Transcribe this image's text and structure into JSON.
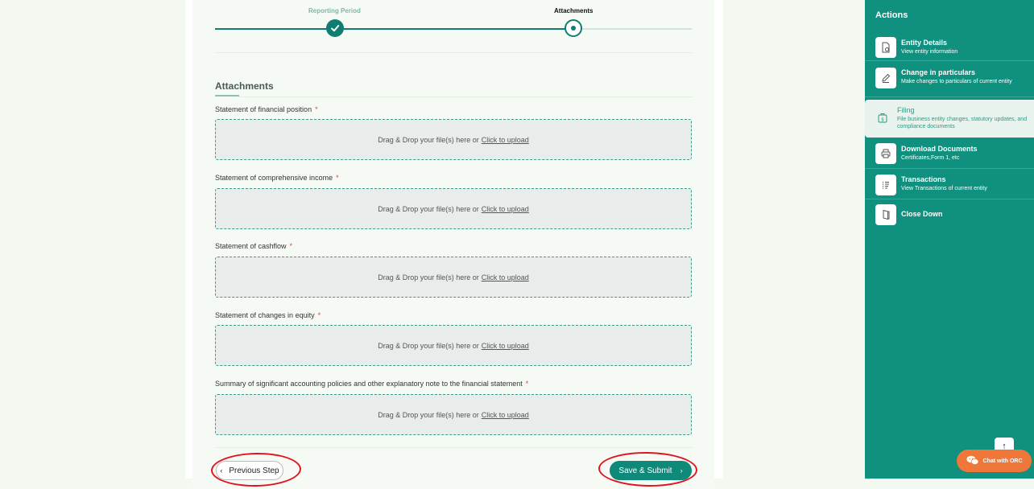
{
  "stepper": {
    "steps": [
      {
        "label": "Reporting Period",
        "state": "done"
      },
      {
        "label": "Attachments",
        "state": "current"
      }
    ]
  },
  "form": {
    "section_title": "Attachments",
    "required_mark": "*",
    "dropzone_text": "Drag & Drop your file(s) here or",
    "dropzone_link": "Click to upload",
    "fields": [
      {
        "label": "Statement of financial position"
      },
      {
        "label": "Statement of comprehensive income"
      },
      {
        "label": "Statement of cashflow"
      },
      {
        "label": "Statement of changes in equity"
      },
      {
        "label": "Summary of significant accounting policies and other explanatory note to the financial statement"
      }
    ],
    "prev_label": "Previous Step",
    "submit_label": "Save & Submit"
  },
  "sidebar": {
    "title": "Actions",
    "items": [
      {
        "name": "Entity Details",
        "desc": "View entity information",
        "icon": "document-view-icon",
        "active": false
      },
      {
        "name": "Change in particulars",
        "desc": "Make changes to particulars of current entity",
        "icon": "pencil-icon",
        "active": false
      },
      {
        "name": "Filing",
        "desc": "File business entity changes, statutory updates, and compliance documents",
        "icon": "money-file-icon",
        "active": true
      },
      {
        "name": "Download Documents",
        "desc": "Certificates,Form 1, etc",
        "icon": "printer-icon",
        "active": false
      },
      {
        "name": "Transactions",
        "desc": "View Transactions of current entity",
        "icon": "list-icon",
        "active": false
      },
      {
        "name": "Close Down",
        "desc": "",
        "icon": "door-icon",
        "active": false
      }
    ]
  },
  "chat": {
    "label": "Chat with ORC"
  },
  "colors": {
    "primary": "#0f8a7a",
    "sidebar": "#10907e",
    "chat": "#f0773a",
    "annotation": "#e0141e"
  }
}
